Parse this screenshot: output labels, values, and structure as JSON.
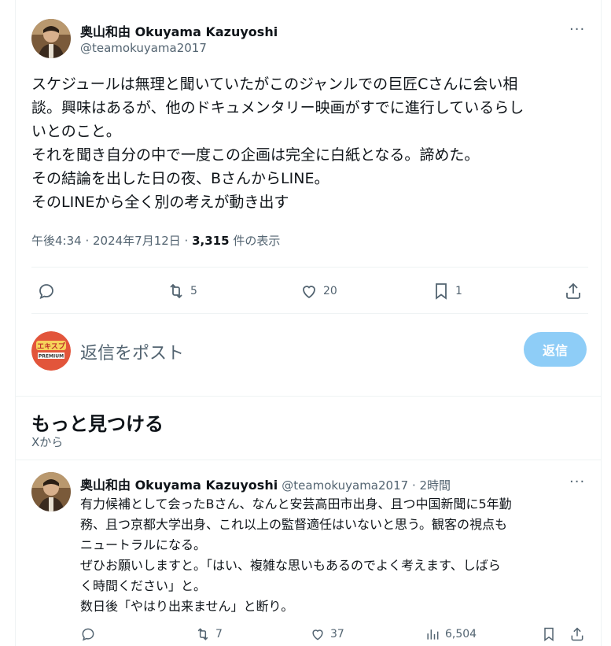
{
  "tweet": {
    "author_name": "奥山和由 Okuyama Kazuyoshi",
    "author_handle": "@teamokuyama2017",
    "more": "···",
    "text": "スケジュールは無理と聞いていたがこのジャンルでの巨匠Cさんに会い相\n談。興味はあるが、他のドキュメンタリー映画がすでに進行しているらし\nいとのこと。\nそれを聞き自分の中で一度この企画は完全に白紙となる。諦めた。\nその結論を出した日の夜、BさんからLINE。\nそのLINEから全く別の考えが動き出す",
    "time": "午後4:34 · 2024年7月12日 · ",
    "views_count": "3,315",
    "views_label": " 件の表示",
    "actions": {
      "reply_icon": "reply-icon",
      "retweet_count": "5",
      "like_count": "20",
      "bookmark_count": "1"
    }
  },
  "reply_box": {
    "avatar_label_top": "エキスプ",
    "avatar_label_mid": "PREMIUM",
    "placeholder": "返信をポスト",
    "button": "返信"
  },
  "discover": {
    "title": "もっと見つける",
    "subtitle": "Xから"
  },
  "related_tweet": {
    "author_name": "奥山和由 Okuyama Kazuyoshi",
    "author_handle": "@teamokuyama2017",
    "time": " · 2時間",
    "more": "···",
    "text": "有力候補として会ったBさん、なんと安芸高田市出身、且つ中国新聞に5年勤\n務、且つ京都大学出身、これ以上の監督適任はいないと思う。観客の視点も\nニュートラルになる。\nぜひお願いしますと。「はい、複雑な思いもあるのでよく考えます、しばら\nく時間ください」と。\n数日後「やはり出来ません」と断り。",
    "reply_count": "",
    "retweet_count": "7",
    "like_count": "37",
    "views_count": "6,504"
  },
  "colors": {
    "text": "#0f1419",
    "muted": "#536471",
    "divider": "#eff3f4",
    "reply_button": "#8ecdf7"
  }
}
